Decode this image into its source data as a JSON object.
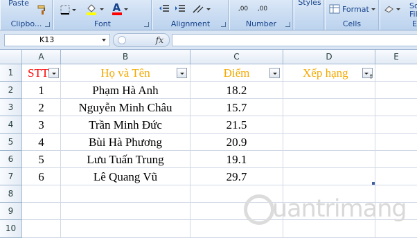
{
  "ribbon": {
    "clipboard": {
      "paste_label": "Paste",
      "group_label": "Clipbo..."
    },
    "font": {
      "group_label": "Font",
      "color_letter": "A"
    },
    "alignment": {
      "group_label": "Alignment"
    },
    "number": {
      "group_label": "Number",
      "inc_decimal": ",00",
      "dec_decimal": ",00"
    },
    "styles": {
      "label": "Styles"
    },
    "cells": {
      "format_label": "Format",
      "group_label": "Cells"
    },
    "editing": {
      "group_label": "E",
      "label_partial": "So",
      "label_partial2": "Fil"
    },
    "colors": {
      "fill": "#ffff00",
      "font_color": "#ff0000",
      "group_text": "#15428b"
    }
  },
  "formula_bar": {
    "name_box": "K13",
    "fx_label": "fx",
    "formula_value": ""
  },
  "sheet": {
    "columns": [
      "A",
      "B",
      "C",
      "D",
      "E"
    ],
    "rows": [
      "1",
      "2",
      "3",
      "4",
      "5",
      "6",
      "7",
      "8",
      "9",
      "10"
    ],
    "headers": {
      "stt": "STT",
      "ho_ten": "Họ và Tên",
      "diem": "Điểm",
      "xep_hang": "Xếp hạng"
    },
    "data": [
      {
        "stt": "1",
        "name": "Phạm Hà Anh",
        "score": "18.2",
        "rank": ""
      },
      {
        "stt": "2",
        "name": "Nguyễn Minh Châu",
        "score": "15.7",
        "rank": ""
      },
      {
        "stt": "3",
        "name": "Trần Minh Đức",
        "score": "21.5",
        "rank": ""
      },
      {
        "stt": "4",
        "name": "Bùi Hà Phương",
        "score": "20.9",
        "rank": ""
      },
      {
        "stt": "5",
        "name": "Lưu Tuấn Trung",
        "score": "19.1",
        "rank": ""
      },
      {
        "stt": "6",
        "name": "Lê Quang Vũ",
        "score": "29.7",
        "rank": ""
      }
    ],
    "header_colors": {
      "stt": "#ff0000",
      "others": "#f4a900"
    }
  },
  "watermark": {
    "text": "uantrimang"
  }
}
